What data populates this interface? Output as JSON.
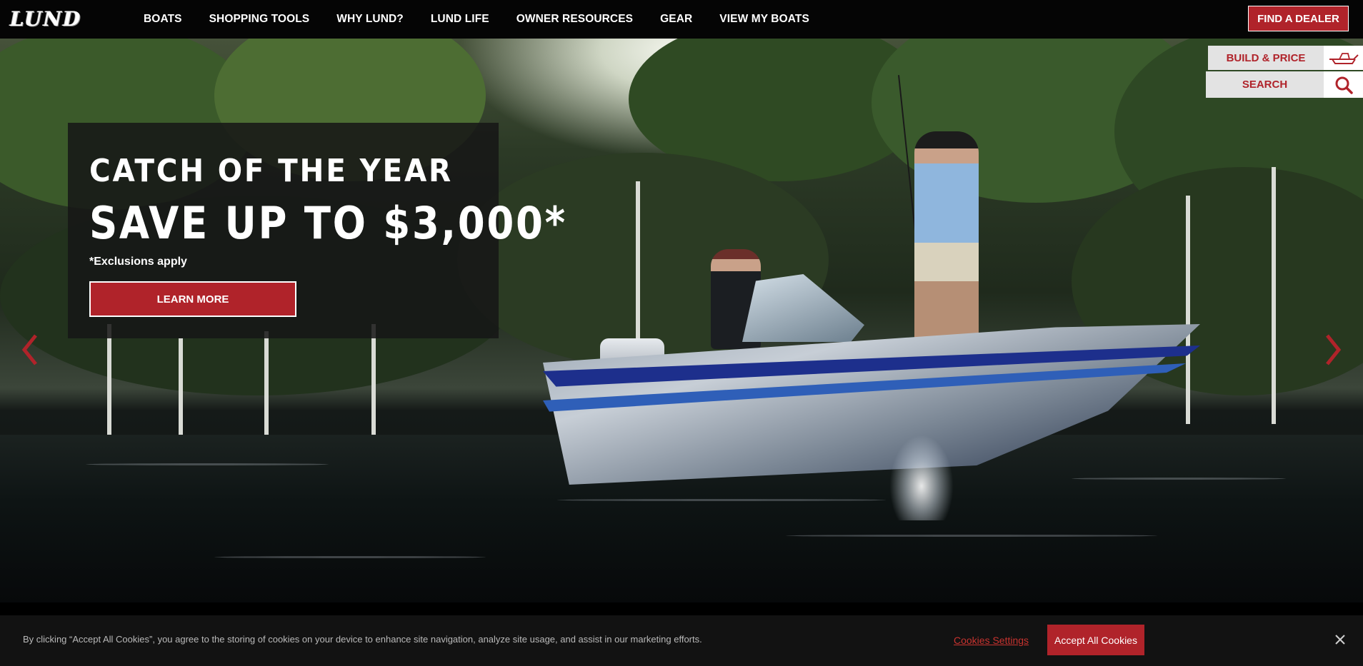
{
  "brand": {
    "logo_text": "LUND"
  },
  "nav": {
    "items": [
      {
        "label": "BOATS"
      },
      {
        "label": "SHOPPING TOOLS"
      },
      {
        "label": "WHY LUND?"
      },
      {
        "label": "LUND LIFE"
      },
      {
        "label": "OWNER RESOURCES"
      },
      {
        "label": "GEAR"
      },
      {
        "label": "VIEW MY BOATS"
      }
    ],
    "find_dealer_label": "FIND A DEALER"
  },
  "utility": {
    "build_price_label": "BUILD & PRICE",
    "build_price_icon": "boat-icon",
    "search_label": "SEARCH",
    "search_icon": "search-icon"
  },
  "hero": {
    "headline": "CATCH OF THE YEAR",
    "subheadline": "SAVE UP TO $3,000*",
    "note": "*Exclusions apply",
    "cta_label": "LEARN MORE",
    "prev_icon": "chevron-left-icon",
    "next_icon": "chevron-right-icon"
  },
  "cookie": {
    "text": "By clicking “Accept All Cookies”, you agree to the storing of cookies on your device to enhance site navigation, analyze site usage, and assist in our marketing efforts.",
    "settings_label": "Cookies Settings",
    "accept_label": "Accept All Cookies",
    "close_icon": "close-icon"
  },
  "colors": {
    "brand_red": "#b0232a",
    "nav_bg": "#050505",
    "cookie_bg": "#121212"
  }
}
